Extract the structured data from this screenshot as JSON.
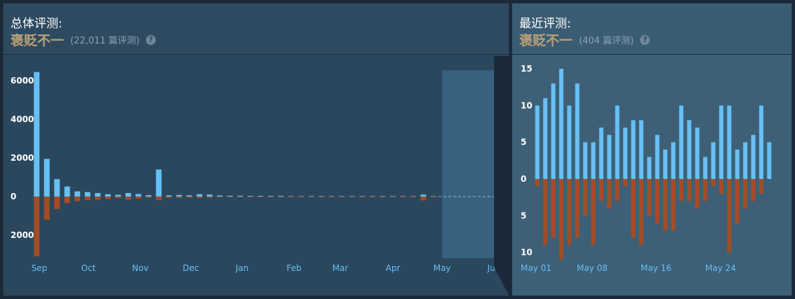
{
  "overall": {
    "title": "总体评测:",
    "rating": "褒贬不一",
    "count": "(22,011 篇评测)",
    "help_icon": "?",
    "chart_data": {
      "type": "bar",
      "title": "",
      "y_ticks": [
        "6000",
        "4000",
        "2000",
        "0",
        "2000"
      ],
      "ylim": [
        -2000,
        6000
      ],
      "x_labels": [
        "Sep",
        "Oct",
        "Nov",
        "Dec",
        "Jan",
        "Feb",
        "Mar",
        "Apr",
        "May",
        "Jun"
      ],
      "series": [
        {
          "values": [
            6450,
            1950,
            900,
            520,
            270,
            230,
            180,
            120,
            90,
            180,
            130,
            70,
            1400,
            60,
            80,
            60,
            120,
            100,
            50,
            40,
            40,
            30,
            30,
            30,
            30,
            20,
            20,
            20,
            20,
            20,
            20,
            20,
            20,
            20,
            20,
            20,
            20,
            20,
            100,
            20
          ],
          "color": "#66c0f4"
        },
        {
          "values": [
            -3100,
            -1200,
            -650,
            -350,
            -240,
            -190,
            -170,
            -130,
            -90,
            -160,
            -110,
            -70,
            -190,
            -60,
            -70,
            -60,
            -80,
            -60,
            -40,
            -30,
            -30,
            -30,
            -30,
            -20,
            -20,
            -20,
            -20,
            -20,
            -20,
            -20,
            -20,
            -20,
            -20,
            -20,
            -20,
            -20,
            -20,
            -20,
            -200,
            -20
          ],
          "color": "#a34c25"
        }
      ],
      "highlight_range": "May – Jun"
    }
  },
  "recent": {
    "title": "最近评测:",
    "rating": "褒贬不一",
    "count": "(404 篇评测)",
    "help_icon": "?",
    "chart_data": {
      "type": "bar",
      "title": "",
      "y_ticks": [
        "15",
        "10",
        "5",
        "0",
        "5",
        "10"
      ],
      "ylim": [
        -10,
        15
      ],
      "x_labels": [
        "May 01",
        "May 08",
        "May 16",
        "May 24"
      ],
      "series": [
        {
          "values": [
            10,
            11,
            13,
            15,
            10,
            13,
            5,
            5,
            7,
            6,
            10,
            7,
            8,
            8,
            3,
            6,
            4,
            5,
            10,
            8,
            7,
            3,
            5,
            10,
            10,
            4,
            5,
            6,
            10,
            5
          ],
          "color": "#66c0f4"
        },
        {
          "values": [
            -1,
            -9,
            -8,
            -11,
            -9,
            -8,
            -5,
            -9,
            -3,
            -4,
            -3,
            -1,
            -8,
            -9,
            -5,
            -6,
            -7,
            -7,
            -3,
            -3,
            -4,
            -3,
            -1,
            -2,
            -10,
            -6,
            -4,
            -3,
            -2,
            0
          ],
          "color": "#a34c25"
        }
      ]
    }
  }
}
